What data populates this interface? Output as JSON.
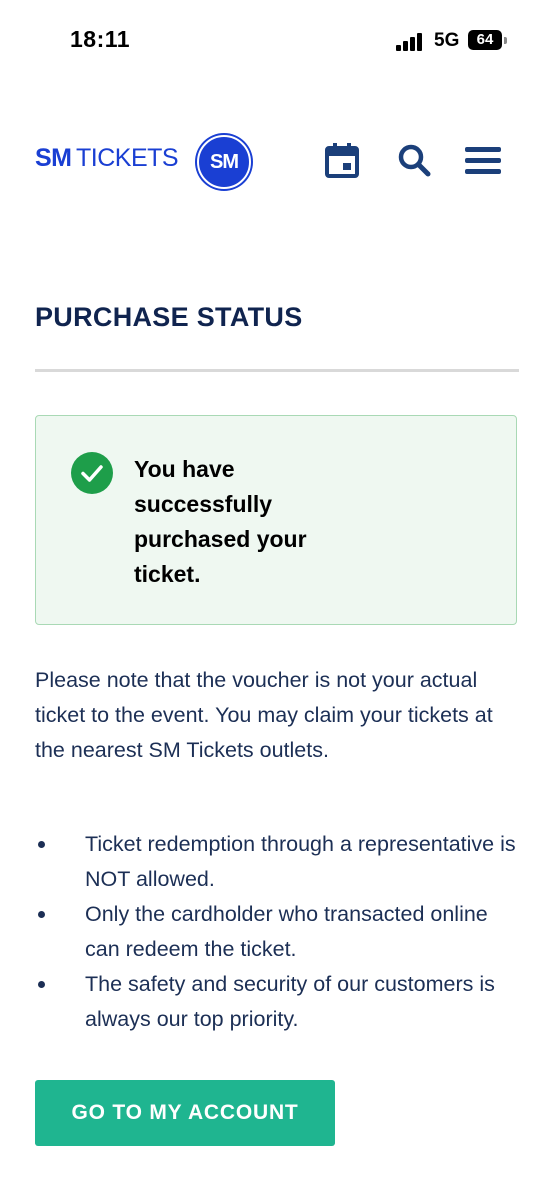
{
  "status_bar": {
    "time": "18:11",
    "network": "5G",
    "battery": "64"
  },
  "header": {
    "logo_bold": "SM",
    "logo_regular": "TICKETS",
    "logo_mark": "SM",
    "icons": [
      "calendar-icon",
      "search-icon",
      "menu-icon"
    ],
    "brand_color": "#1a3fd3",
    "icon_color": "#1b3f7a"
  },
  "page": {
    "title": "PURCHASE STATUS",
    "success_message": "You have successfully purchased your ticket.",
    "note": "Please note that the voucher is not your actual ticket to the event. You may claim your tickets at the nearest SM Tickets outlets.",
    "bullets": [
      "Ticket redemption through a representative is NOT allowed.",
      "Only the cardholder who transacted online can redeem the ticket.",
      "The safety and security of our customers is always our top priority."
    ],
    "cta_label": "GO TO MY ACCOUNT",
    "success_color": "#1e9e4a",
    "cta_color": "#1fb590"
  }
}
